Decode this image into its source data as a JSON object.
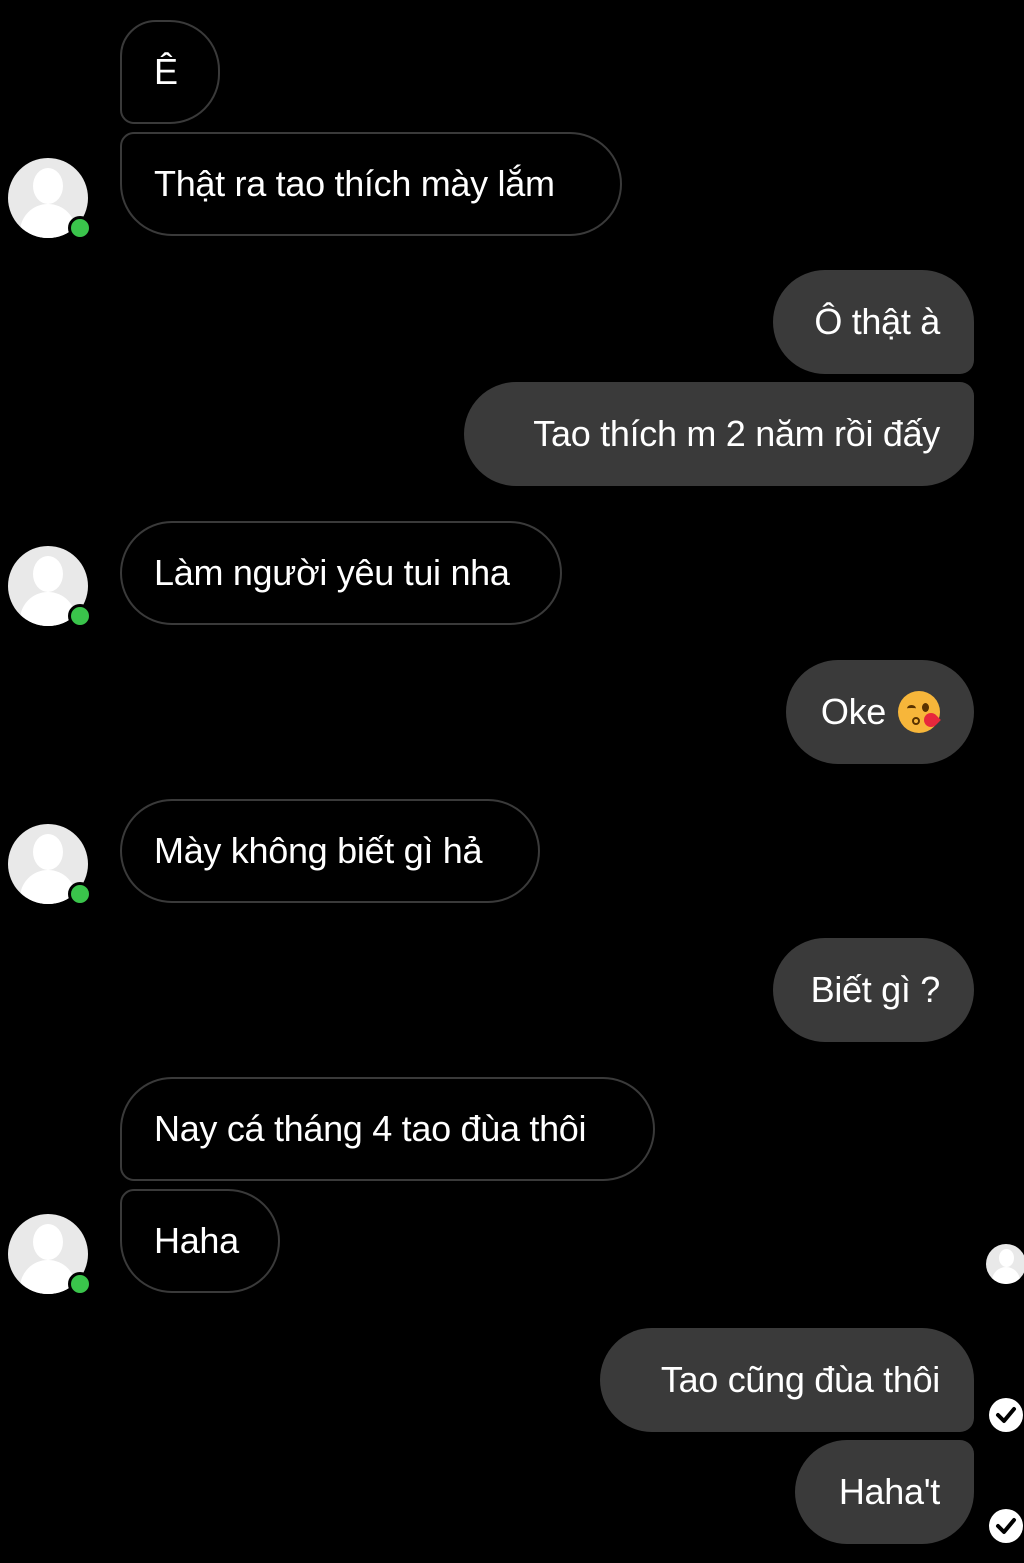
{
  "messages": [
    {
      "side": "in",
      "text": "Ê"
    },
    {
      "side": "in",
      "text": "Thật ra tao thích mày lắm"
    },
    {
      "side": "out",
      "text": "Ô thật à"
    },
    {
      "side": "out",
      "text": "Tao thích m 2 năm rồi đấy"
    },
    {
      "side": "in",
      "text": "Làm người yêu tui nha"
    },
    {
      "side": "out",
      "text": "Oke",
      "emoji": "kissing-heart-emoji"
    },
    {
      "side": "in",
      "text": "Mày không biết gì hả"
    },
    {
      "side": "out",
      "text": "Biết gì ?"
    },
    {
      "side": "in",
      "text": "Nay cá tháng 4 tao đùa thôi"
    },
    {
      "side": "in",
      "text": "Haha"
    },
    {
      "side": "out",
      "text": "Tao cũng đùa thôi"
    },
    {
      "side": "out",
      "text": "Haha't"
    }
  ],
  "colors": {
    "background": "#000000",
    "incoming_border": "#3a3a3a",
    "outgoing_bubble": "#3a3a3a",
    "online": "#3ac44b",
    "text": "#ffffff"
  },
  "icons": [
    "avatar-placeholder-icon",
    "online-status-icon",
    "seen-avatar-icon",
    "sent-check-icon"
  ]
}
